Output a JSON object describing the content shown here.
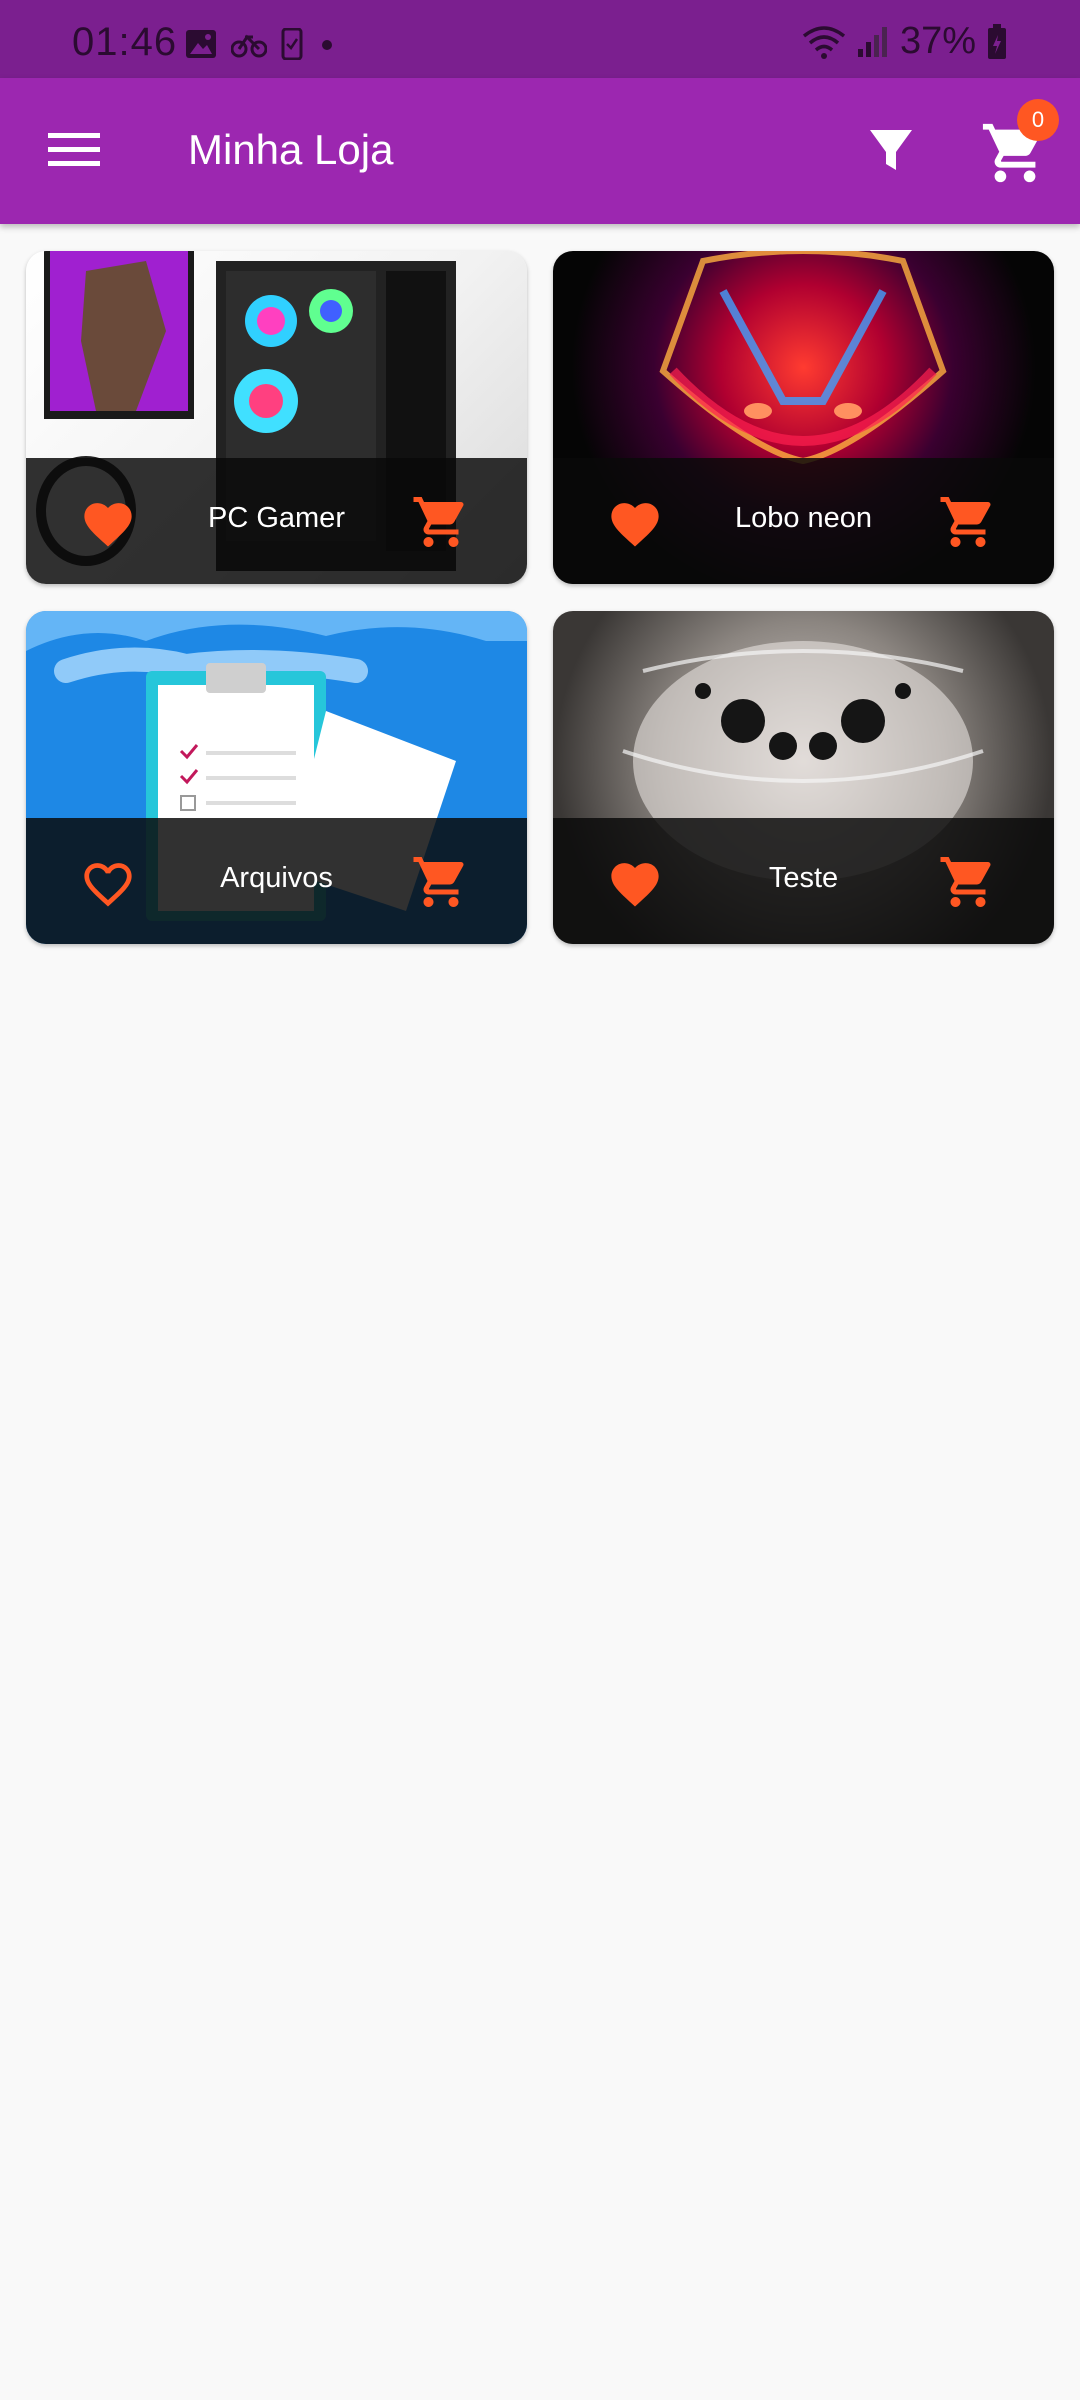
{
  "status_bar": {
    "time": "01:46",
    "battery": "37%",
    "icons": [
      "image-icon",
      "bike-icon",
      "phone-check-icon",
      "dot-icon",
      "wifi-icon",
      "signal-icon",
      "battery-icon"
    ]
  },
  "app_bar": {
    "title": "Minha Loja",
    "menu_icon": "menu-icon",
    "filter_icon": "filter-icon",
    "cart_icon": "cart-icon",
    "cart_count": "0"
  },
  "colors": {
    "primary": "#9c27b0",
    "status_bar": "#7b1f8f",
    "accent": "#ff5722",
    "background": "#f9f9f9"
  },
  "products": [
    {
      "name": "PC Gamer",
      "favorite": true,
      "image": "gaming-pc-image"
    },
    {
      "name": "Lobo neon",
      "favorite": true,
      "image": "neon-wolf-image"
    },
    {
      "name": "Arquivos",
      "favorite": false,
      "image": "clipboard-documents-image"
    },
    {
      "name": "Teste",
      "favorite": true,
      "image": "spider-closeup-image"
    }
  ]
}
